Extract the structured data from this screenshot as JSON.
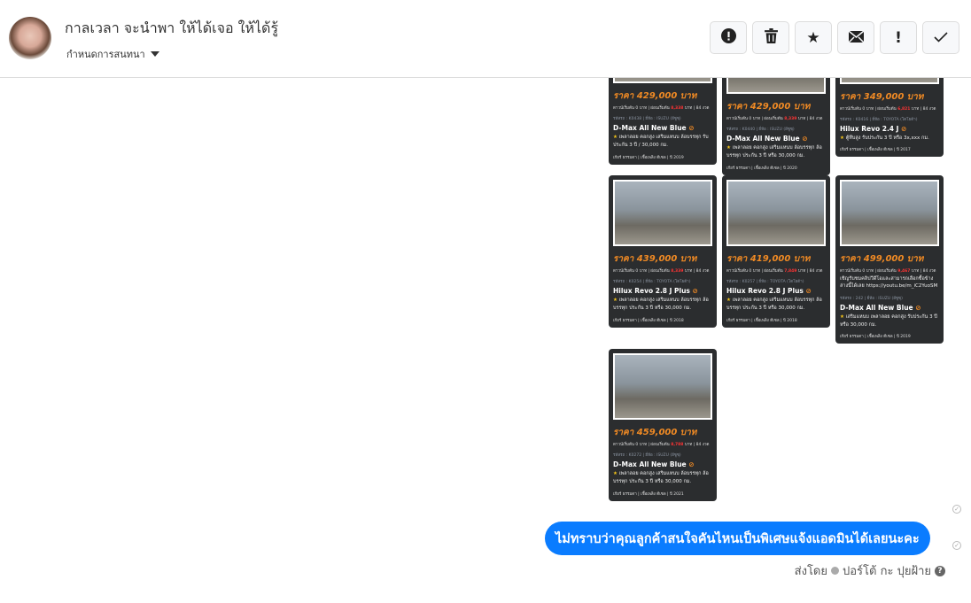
{
  "header": {
    "title": "กาลเวลา จะนำพา ให้ได้เจอ ให้ได้รู้",
    "subtitle": "กำหนดการสนทนา",
    "actions": [
      {
        "name": "alert-circle",
        "glyph": "⬤"
      },
      {
        "name": "trash",
        "glyph": "🗑"
      },
      {
        "name": "star",
        "glyph": "★"
      },
      {
        "name": "mail",
        "glyph": "✉"
      },
      {
        "name": "exclamation",
        "glyph": "!"
      },
      {
        "name": "check",
        "glyph": "✓"
      }
    ]
  },
  "cards": [
    {
      "price": "ราคา 429,000 บาท",
      "fin_a": "ดาวน์เริ่มต้น 0 บาท | ผ่อนเริ่มต้น ",
      "fin_amt": "8,338",
      "fin_b": " บาท | 84 งวด",
      "meta": "รหัสรถ : K0438 | ยี่ห้อ : ISUZU (อีซูซุ)",
      "title": "D-Max All New Blue",
      "desc": "เพลาลอย คอกสูง เสริมแหนบ ล้อบรรทุก รับประกัน 3 ปี / 30,000 กม.",
      "foot": "เกียร์ ธรรมดา | เชื้อเพลิง ดีเซล | ปี 2019"
    },
    {
      "price": "ราคา 429,000 บาท",
      "fin_a": "ดาวน์เริ่มต้น 0 บาท | ผ่อนเริ่มต้น ",
      "fin_amt": "8,339",
      "fin_b": " บาท | 84 งวด",
      "meta": "รหัสรถ : K0440 | ยี่ห้อ : ISUZU (อีซูซุ)",
      "title": "D-Max All New Blue",
      "desc": "เพลาลอย คอกสูง เสริมแหนบ ล้อบรรทุก ล้อบรรทุก ประกัน 3 ปี หรือ 30,000 กม.",
      "foot": "เกียร์ ธรรมดา | เชื้อเพลิง ดีเซล | ปี 2020"
    },
    {
      "price": "ราคา 349,000 บาท",
      "fin_a": "ดาวน์เริ่มต้น 0 บาท | ผ่อนเริ่มต้น ",
      "fin_amt": "6,821",
      "fin_b": " บาท | 84 งวด",
      "meta": "รหัสรถ : K0416 | ยี่ห้อ : TOYOTA (โตโยต้า)",
      "title": "Hilux Revo 2.4 J",
      "desc": "ตู้ทึบสูง รับประกัน 3 ปี หรือ 3x,xxx กม.",
      "foot": "เกียร์ ธรรมดา | เชื้อเพลิง ดีเซล | ปี 2017"
    },
    {
      "price": "ราคา 439,000 บาท",
      "fin_a": "ดาวน์เริ่มต้น 0 บาท | ผ่อนเริ่มต้น ",
      "fin_amt": "8,339",
      "fin_b": " บาท | 84 งวด",
      "meta": "รหัสรถ : K0254 | ยี่ห้อ : TOYOTA (โตโยต้า)",
      "title": "Hilux Revo 2.8 J Plus",
      "desc": "เพลาลอย คอกสูง เสริมแหนบ ล้อบรรทุก ล้อบรรทุก ประกัน 3 ปี หรือ 30,000 กม.",
      "foot": "เกียร์ ธรรมดา | เชื้อเพลิง ดีเซล | ปี 2018"
    },
    {
      "price": "ราคา 419,000 บาท",
      "fin_a": "ดาวน์เริ่มต้น 0 บาท | ผ่อนเริ่มต้น ",
      "fin_amt": "7,849",
      "fin_b": " บาท | 84 งวด",
      "meta": "รหัสรถ : K0257 | ยี่ห้อ : TOYOTA (โตโยต้า)",
      "title": "Hilux Revo 2.8 J Plus",
      "desc": "เพลาลอย คอกสูง เสริมแหนบ ล้อบรรทุก ล้อบรรทุก ประกัน 3 ปี หรือ 30,000 กม.",
      "foot": "เกียร์ ธรรมดา | เชื้อเพลิง ดีเซล | ปี 2018"
    },
    {
      "price": "ราคา 499,000 บาท",
      "fin_a": "ดาวน์เริ่มต้น 0 บาท | ผ่อนเริ่มต้น ",
      "fin_amt": "9,467",
      "fin_b": " บาท | 84 งวด",
      "extra": "เชิญรับชมคลิปวีดีโอและสามารถเลือกซื้อข้างล่างนี้ได้เลย https://youtu.be/m_iC2YuoSM",
      "meta": "รหัสรถ : 242 | ยี่ห้อ : ISUZU (อีซูซุ)",
      "title": "D-Max All New Blue",
      "desc": "เสริมแหนบ เพลาลอย คอกสูง รับประกัน 3 ปี หรือ 30,000 กม.",
      "foot": "เกียร์ ธรรมดา | เชื้อเพลิง ดีเซล | ปี 2019"
    },
    {
      "price": "ราคา 459,000 บาท",
      "fin_a": "ดาวน์เริ่มต้น 0 บาท | ผ่อนเริ่มต้น ",
      "fin_amt": "8,788",
      "fin_b": " บาท | 84 งวด",
      "meta": "รหัสรถ : K0272 | ยี่ห้อ : ISUZU (อีซูซุ)",
      "title": "D-Max All New Blue",
      "desc": "เพลาลอย คอกสูง เสริมแหนบ ล้อบรรทุก ล้อบรรทุก ประกัน 3 ปี หรือ 30,000 กม.",
      "foot": "เกียร์ ธรรมดา | เชื้อเพลิง ดีเซล | ปี 2021"
    }
  ],
  "message": {
    "text": "ไม่ทราบว่าคุณลูกค้าสนใจคันไหนเป็นพิเศษแจ้งแอดมินได้เลยนะคะ",
    "sent_by_label": "ส่งโดย",
    "sender": "ปอร์โต้ กะ ปุยฝ้าย",
    "accent": "#0a7cff"
  }
}
